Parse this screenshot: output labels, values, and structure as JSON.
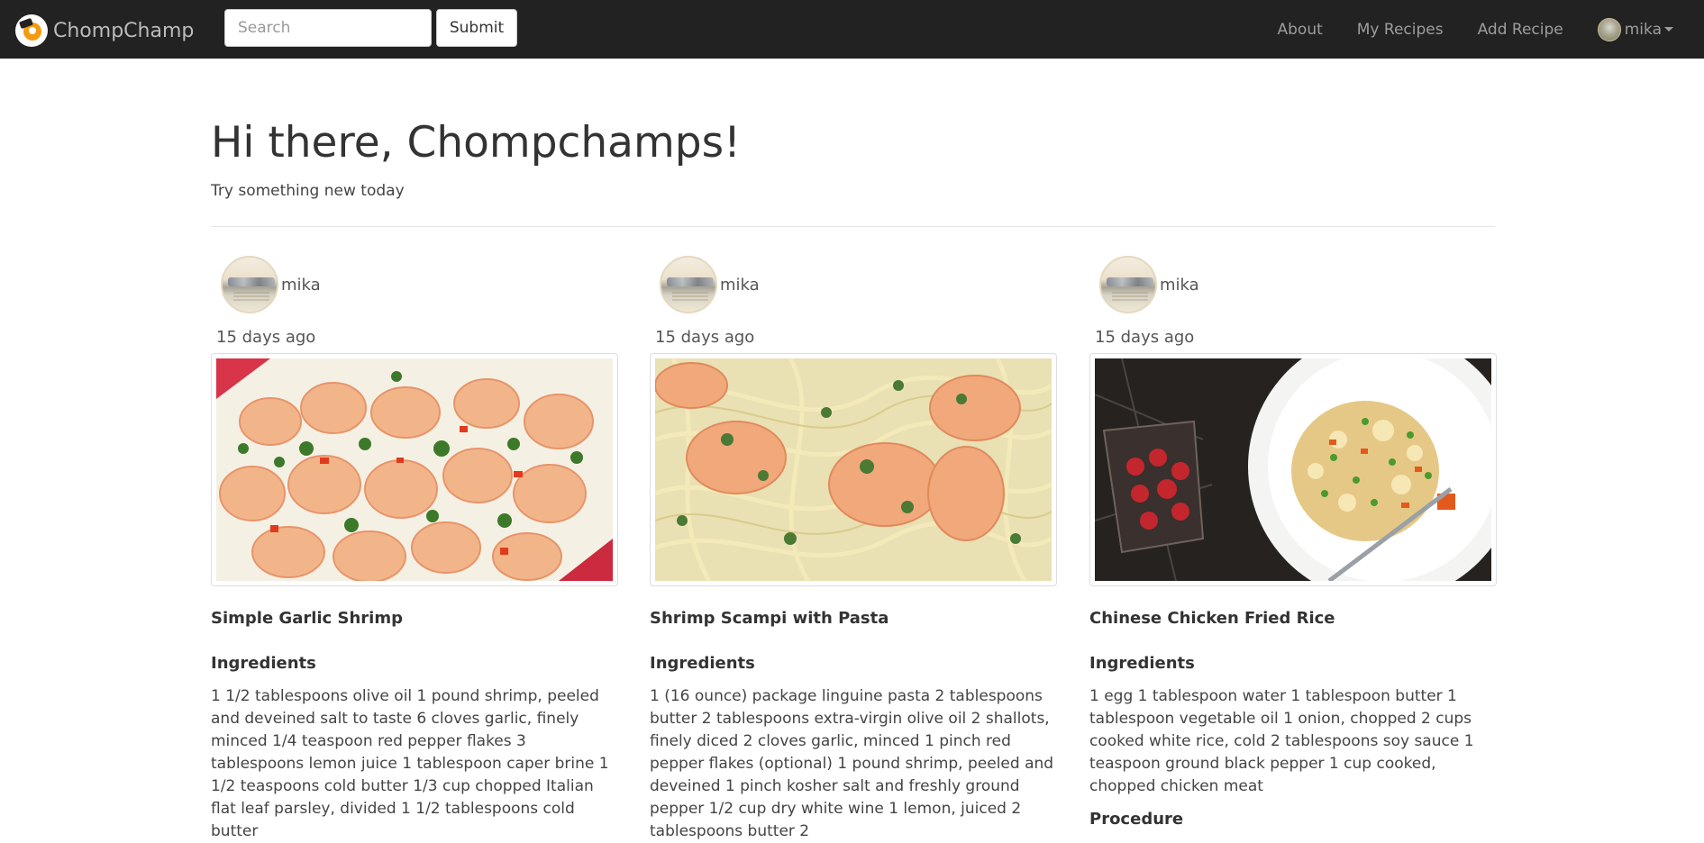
{
  "navbar": {
    "brand": "ChompChamp",
    "search_placeholder": "Search",
    "submit_label": "Submit",
    "links": [
      "About",
      "My Recipes",
      "Add Recipe"
    ],
    "user": "mika"
  },
  "hero": {
    "title": "Hi there, Chompchamps!",
    "subtitle": "Try something new today"
  },
  "recipes": [
    {
      "author": "mika",
      "time": "15 days ago",
      "title": "Simple Garlic Shrimp",
      "ingredients_heading": "Ingredients",
      "ingredients": "1 1/2 tablespoons olive oil 1 pound shrimp, peeled and deveined salt to taste 6 cloves garlic, finely minced 1/4 teaspoon red pepper flakes 3 tablespoons lemon juice 1 tablespoon caper brine 1 1/2 teaspoons cold butter 1/3 cup chopped Italian flat leaf parsley, divided 1 1/2 tablespoons cold butter"
    },
    {
      "author": "mika",
      "time": "15 days ago",
      "title": "Shrimp Scampi with Pasta",
      "ingredients_heading": "Ingredients",
      "ingredients": "1 (16 ounce) package linguine pasta 2 tablespoons butter 2 tablespoons extra-virgin olive oil 2 shallots, finely diced 2 cloves garlic, minced 1 pinch red pepper flakes (optional) 1 pound shrimp, peeled and deveined 1 pinch kosher salt and freshly ground pepper 1/2 cup dry white wine 1 lemon, juiced 2 tablespoons butter 2"
    },
    {
      "author": "mika",
      "time": "15 days ago",
      "title": "Chinese Chicken Fried Rice",
      "ingredients_heading": "Ingredients",
      "ingredients": "1 egg 1 tablespoon water 1 tablespoon butter 1 tablespoon vegetable oil 1 onion, chopped 2 cups cooked white rice, cold 2 tablespoons soy sauce 1 teaspoon ground black pepper 1 cup cooked, chopped chicken meat",
      "procedure_heading": "Procedure"
    }
  ]
}
